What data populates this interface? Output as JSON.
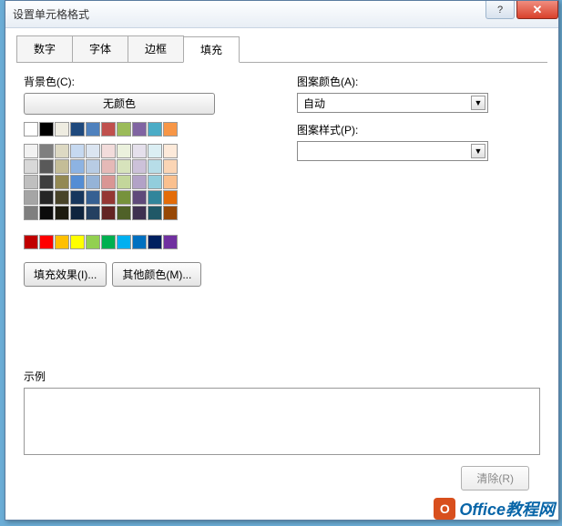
{
  "window": {
    "title": "设置单元格格式"
  },
  "tabs": {
    "number": "数字",
    "font": "字体",
    "border": "边框",
    "fill": "填充"
  },
  "labels": {
    "bg_color": "背景色(C):",
    "no_color": "无颜色",
    "pattern_color": "图案颜色(A):",
    "pattern_style": "图案样式(P):",
    "auto": "自动",
    "fill_effects": "填充效果(I)...",
    "more_colors": "其他颜色(M)...",
    "sample": "示例",
    "clear": "清除(R)"
  },
  "theme_colors_row1": [
    "#ffffff",
    "#000000",
    "#eeece1",
    "#1f497d",
    "#4f81bd",
    "#c0504d",
    "#9bbb59",
    "#8064a2",
    "#4bacc6",
    "#f79646"
  ],
  "theme_shades": [
    [
      "#f2f2f2",
      "#7f7f7f",
      "#ddd9c3",
      "#c6d9f0",
      "#dbe5f1",
      "#f2dcdb",
      "#ebf1dd",
      "#e5e0ec",
      "#dbeef3",
      "#fdeada"
    ],
    [
      "#d8d8d8",
      "#595959",
      "#c4bd97",
      "#8db3e2",
      "#b8cce4",
      "#e5b9b7",
      "#d7e3bc",
      "#ccc1d9",
      "#b7dde8",
      "#fbd5b5"
    ],
    [
      "#bfbfbf",
      "#3f3f3f",
      "#938953",
      "#548dd4",
      "#95b3d7",
      "#d99694",
      "#c3d69b",
      "#b2a2c7",
      "#92cddc",
      "#fac08f"
    ],
    [
      "#a5a5a5",
      "#262626",
      "#494429",
      "#17365d",
      "#366092",
      "#953734",
      "#76923c",
      "#5f497a",
      "#31859b",
      "#e36c09"
    ],
    [
      "#7f7f7f",
      "#0c0c0c",
      "#1d1b10",
      "#0f243e",
      "#244061",
      "#632423",
      "#4f6128",
      "#3f3151",
      "#205867",
      "#974806"
    ]
  ],
  "standard_colors": [
    "#c00000",
    "#ff0000",
    "#ffc000",
    "#ffff00",
    "#92d050",
    "#00b050",
    "#00b0f0",
    "#0070c0",
    "#002060",
    "#7030a0"
  ],
  "watermark": {
    "text": "Office教程网"
  }
}
